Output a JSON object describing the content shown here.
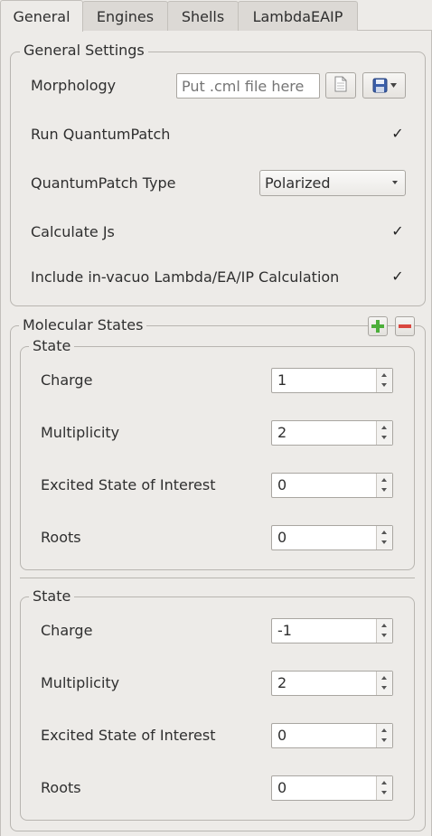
{
  "tabs": [
    "General",
    "Engines",
    "Shells",
    "LambdaEAIP"
  ],
  "general_settings": {
    "title": "General Settings",
    "morphology_label": "Morphology",
    "morphology_placeholder": "Put .cml file here",
    "run_qp_label": "Run QuantumPatch",
    "run_qp_checked": true,
    "qp_type_label": "QuantumPatch Type",
    "qp_type_value": "Polarized",
    "calc_js_label": "Calculate Js",
    "calc_js_checked": true,
    "in_vacuo_label": "Include in-vacuo Lambda/EA/IP Calculation",
    "in_vacuo_checked": true
  },
  "molecular_states": {
    "title": "Molecular States",
    "states": [
      {
        "title": "State",
        "charge_label": "Charge",
        "charge": "1",
        "multiplicity_label": "Multiplicity",
        "multiplicity": "2",
        "excited_label": "Excited State of Interest",
        "excited": "0",
        "roots_label": "Roots",
        "roots": "0"
      },
      {
        "title": "State",
        "charge_label": "Charge",
        "charge": "-1",
        "multiplicity_label": "Multiplicity",
        "multiplicity": "2",
        "excited_label": "Excited State of Interest",
        "excited": "0",
        "roots_label": "Roots",
        "roots": "0"
      }
    ]
  },
  "colors": {
    "add": "#4caf3a",
    "remove": "#d9473f",
    "background": "#edebe8"
  },
  "icons": {
    "file": "document-icon",
    "save": "save-dropdown-icon",
    "check": "checkmark-icon"
  }
}
